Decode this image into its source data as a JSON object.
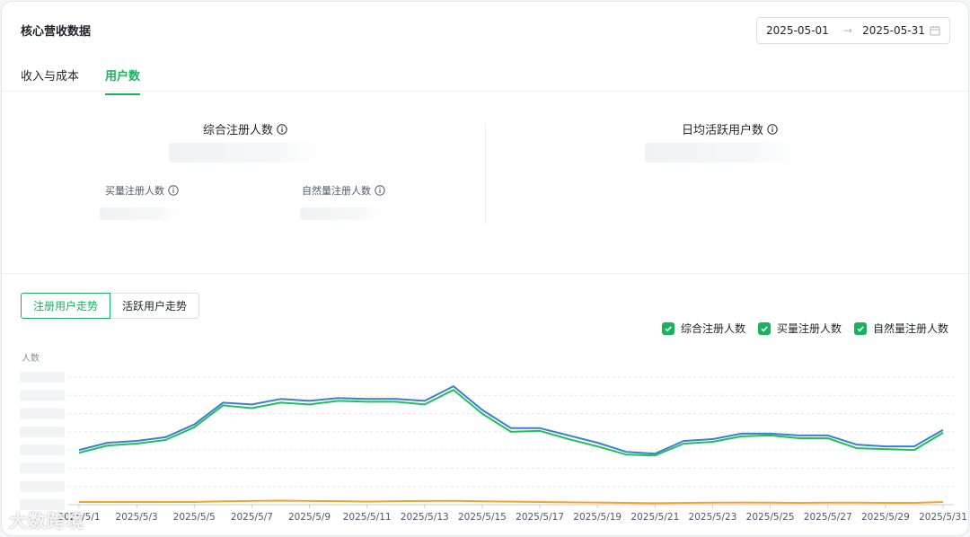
{
  "header": {
    "title": "核心营收数据",
    "date_start": "2025-05-01",
    "date_arrow": "→",
    "date_end": "2025-05-31",
    "calendar_icon": "calendar-icon"
  },
  "tabs": [
    {
      "label": "收入与成本",
      "active": false
    },
    {
      "label": "用户数",
      "active": true
    }
  ],
  "metrics": {
    "total_reg": {
      "label": "综合注册人数",
      "icon": "info-icon"
    },
    "bought_reg": {
      "label": "买量注册人数",
      "icon": "info-icon"
    },
    "natural_reg": {
      "label": "自然量注册人数",
      "icon": "info-icon"
    },
    "dau": {
      "label": "日均活跃用户数",
      "icon": "info-icon"
    }
  },
  "segment": {
    "items": [
      {
        "label": "注册用户走势",
        "active": true
      },
      {
        "label": "活跃用户走势",
        "active": false
      }
    ]
  },
  "legend": [
    {
      "label": "综合注册人数",
      "checked": true
    },
    {
      "label": "买量注册人数",
      "checked": true
    },
    {
      "label": "自然量注册人数",
      "checked": true
    }
  ],
  "colors": {
    "accent": "#17b35c",
    "series_total": "#3a7fd0",
    "series_bought": "#1fbf5f",
    "series_natural": "#f4a32a"
  },
  "watermark": "大数跨境",
  "chart_data": {
    "type": "line",
    "ylabel": "人数",
    "x": [
      "2025/5/1",
      "2025/5/2",
      "2025/5/3",
      "2025/5/4",
      "2025/5/5",
      "2025/5/6",
      "2025/5/7",
      "2025/5/8",
      "2025/5/9",
      "2025/5/10",
      "2025/5/11",
      "2025/5/12",
      "2025/5/13",
      "2025/5/14",
      "2025/5/15",
      "2025/5/16",
      "2025/5/17",
      "2025/5/18",
      "2025/5/19",
      "2025/5/20",
      "2025/5/21",
      "2025/5/22",
      "2025/5/23",
      "2025/5/24",
      "2025/5/25",
      "2025/5/26",
      "2025/5/27",
      "2025/5/28",
      "2025/5/29",
      "2025/5/30",
      "2025/5/31"
    ],
    "tick_labels": [
      "2025/5/1",
      "2025/5/3",
      "2025/5/5",
      "2025/5/7",
      "2025/5/9",
      "2025/5/11",
      "2025/5/13",
      "2025/5/15",
      "2025/5/17",
      "2025/5/19",
      "2025/5/21",
      "2025/5/23",
      "2025/5/25",
      "2025/5/27",
      "2025/5/29",
      "2025/5/31"
    ],
    "ylim": [
      0,
      7
    ],
    "grid": true,
    "series": [
      {
        "name": "综合注册人数",
        "values": [
          3.0,
          3.4,
          3.5,
          3.7,
          4.4,
          5.6,
          5.5,
          5.8,
          5.7,
          5.85,
          5.8,
          5.8,
          5.7,
          6.5,
          5.2,
          4.2,
          4.2,
          3.8,
          3.4,
          2.9,
          2.8,
          3.5,
          3.6,
          3.9,
          3.9,
          3.8,
          3.8,
          3.3,
          3.2,
          3.2,
          4.1
        ]
      },
      {
        "name": "买量注册人数",
        "values": [
          2.85,
          3.25,
          3.35,
          3.55,
          4.25,
          5.45,
          5.3,
          5.6,
          5.5,
          5.7,
          5.65,
          5.65,
          5.5,
          6.3,
          5.0,
          4.0,
          4.05,
          3.6,
          3.2,
          2.75,
          2.7,
          3.35,
          3.45,
          3.75,
          3.8,
          3.65,
          3.65,
          3.1,
          3.05,
          3.0,
          3.95
        ]
      },
      {
        "name": "自然量注册人数",
        "values": [
          0.15,
          0.15,
          0.15,
          0.15,
          0.15,
          0.18,
          0.2,
          0.22,
          0.2,
          0.19,
          0.17,
          0.19,
          0.2,
          0.21,
          0.18,
          0.17,
          0.15,
          0.13,
          0.12,
          0.1,
          0.08,
          0.1,
          0.11,
          0.12,
          0.11,
          0.1,
          0.11,
          0.11,
          0.1,
          0.1,
          0.15
        ]
      }
    ]
  }
}
